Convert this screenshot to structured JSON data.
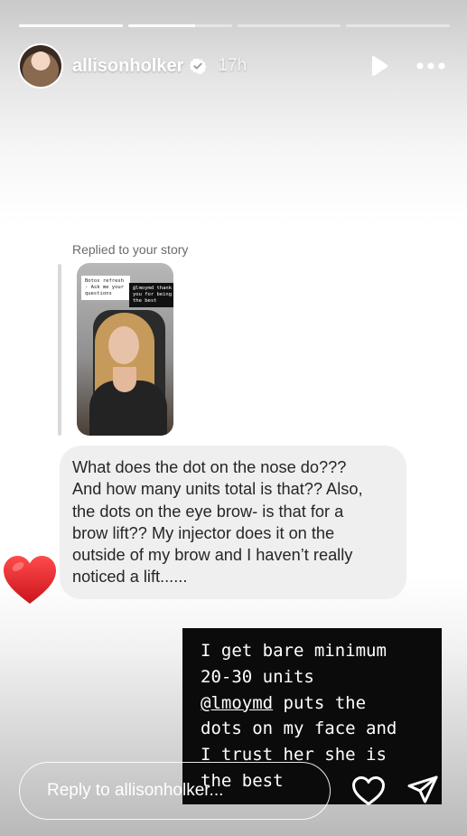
{
  "progress": [
    {
      "fill": 1.0
    },
    {
      "fill": 0.65
    },
    {
      "fill": 0.0
    },
    {
      "fill": 0.0
    }
  ],
  "header": {
    "username": "allisonholker",
    "time_ago": "17h",
    "icons": [
      "verified-badge-icon",
      "play-icon",
      "more-options-icon"
    ]
  },
  "reply_context": {
    "label": "Replied to your story",
    "thumbnail": {
      "note_left": "Botox refresh - Ask me your questions",
      "note_right": "@lmoymd thank you for being the best"
    }
  },
  "message": {
    "lines": [
      "What does the dot on the nose do???",
      "And how many units total is that?? Also,",
      "the dots on the eye brow- is that for a",
      "brow lift?? My injector does it on the",
      "outside of my brow and I haven’t really",
      "noticed a lift......"
    ],
    "reaction": "heart"
  },
  "text_overlay": {
    "line1": "I get bare minimum",
    "line2": "20-30 units",
    "mention": "@lmoymd",
    "line3_rest": " puts the",
    "line4": "dots on my face and",
    "line5": "I trust her she is",
    "line6": "the best"
  },
  "reply_bar": {
    "placeholder": "Reply to allisonholker..."
  },
  "colors": {
    "bubble": "#efefef",
    "text_box": "#0b0b0b",
    "heart": "#e0262f"
  }
}
